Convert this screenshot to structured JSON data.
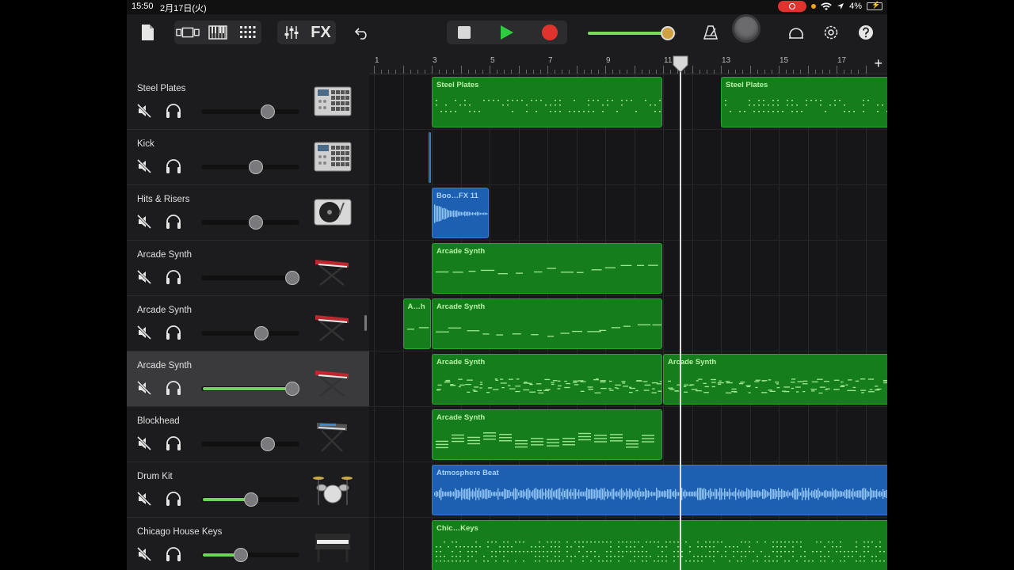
{
  "status_bar": {
    "time": "15:50",
    "date": "2月17日(火)",
    "battery": "4%"
  },
  "toolbar": {
    "fx_label": "FX"
  },
  "transport": {
    "master_volume": 0.9
  },
  "ruler": {
    "bars": [
      "1",
      "3",
      "5",
      "7",
      "9",
      "11",
      "13",
      "15",
      "17"
    ],
    "playhead_bar": 11.6
  },
  "tracks": [
    {
      "name": "Steel Plates",
      "volume": 0.68,
      "active_fill": false,
      "instrument": "drum-machine"
    },
    {
      "name": "Kick",
      "volume": 0.56,
      "active_fill": false,
      "instrument": "drum-machine"
    },
    {
      "name": "Hits & Risers",
      "volume": 0.56,
      "active_fill": false,
      "instrument": "turntable"
    },
    {
      "name": "Arcade Synth",
      "volume": 0.93,
      "active_fill": false,
      "instrument": "synth-keyboard"
    },
    {
      "name": "Arcade Synth",
      "volume": 0.61,
      "active_fill": false,
      "instrument": "synth-keyboard"
    },
    {
      "name": "Arcade Synth",
      "volume": 0.93,
      "active_fill": true,
      "selected": true,
      "instrument": "synth-keyboard"
    },
    {
      "name": "Blockhead",
      "volume": 0.68,
      "active_fill": false,
      "instrument": "keyboard-stand"
    },
    {
      "name": "Drum Kit",
      "volume": 0.51,
      "active_fill": true,
      "instrument": "drum-kit"
    },
    {
      "name": "Chicago House Keys",
      "volume": 0.4,
      "active_fill": true,
      "instrument": "electric-piano"
    }
  ],
  "regions": [
    {
      "lane": 0,
      "type": "midi",
      "name": "Steel Plates",
      "start": 3,
      "end": 11
    },
    {
      "lane": 0,
      "type": "midi",
      "name": "Steel Plates",
      "start": 13,
      "end": 19
    },
    {
      "lane": 1,
      "type": "audio",
      "name": "",
      "start": 2.9,
      "end": 3
    },
    {
      "lane": 2,
      "type": "audio",
      "name": "Boo…FX 11",
      "start": 3,
      "end": 5
    },
    {
      "lane": 3,
      "type": "midi",
      "name": "Arcade Synth",
      "start": 3,
      "end": 11
    },
    {
      "lane": 4,
      "type": "midi",
      "name": "A…h",
      "start": 2,
      "end": 3
    },
    {
      "lane": 4,
      "type": "midi",
      "name": "Arcade Synth",
      "start": 3,
      "end": 11
    },
    {
      "lane": 5,
      "type": "midi",
      "name": "Arcade Synth",
      "start": 3,
      "end": 11
    },
    {
      "lane": 5,
      "type": "midi",
      "name": "Arcade Synth",
      "start": 11,
      "end": 19
    },
    {
      "lane": 6,
      "type": "midi",
      "name": "Arcade Synth",
      "start": 3,
      "end": 11
    },
    {
      "lane": 7,
      "type": "audio",
      "name": "Atmosphere Beat",
      "start": 3,
      "end": 19
    },
    {
      "lane": 8,
      "type": "midi",
      "name": "Chic…Keys",
      "start": 3,
      "end": 19
    }
  ],
  "colors": {
    "midi_region": "#157d1c",
    "audio_region": "#1d5fb0",
    "record": "#e0332e",
    "play": "#2ecc40",
    "volume_fill": "#6fd45a"
  }
}
